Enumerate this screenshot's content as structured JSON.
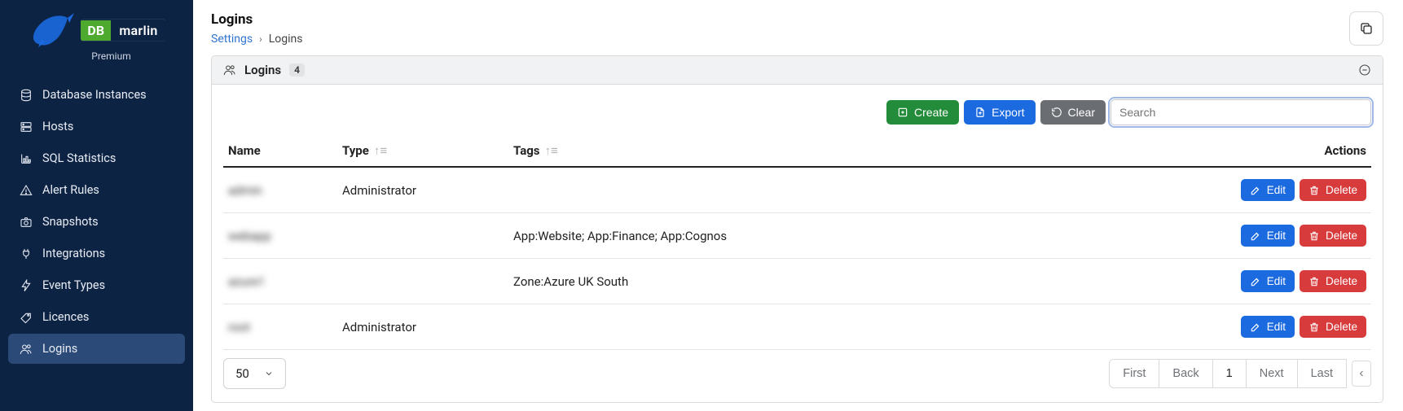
{
  "brand": {
    "db": "DB",
    "marlin": "marlin",
    "tier": "Premium"
  },
  "sidebar": {
    "items": [
      {
        "label": "Database Instances",
        "name": "nav-database-instances",
        "icon": "database-icon"
      },
      {
        "label": "Hosts",
        "name": "nav-hosts",
        "icon": "server-icon"
      },
      {
        "label": "SQL Statistics",
        "name": "nav-sql-statistics",
        "icon": "bar-chart-icon"
      },
      {
        "label": "Alert Rules",
        "name": "nav-alert-rules",
        "icon": "alert-icon"
      },
      {
        "label": "Snapshots",
        "name": "nav-snapshots",
        "icon": "camera-icon"
      },
      {
        "label": "Integrations",
        "name": "nav-integrations",
        "icon": "plug-icon"
      },
      {
        "label": "Event Types",
        "name": "nav-event-types",
        "icon": "lightning-icon"
      },
      {
        "label": "Licences",
        "name": "nav-licences",
        "icon": "tag-icon"
      },
      {
        "label": "Logins",
        "name": "nav-logins",
        "icon": "users-icon",
        "active": true
      }
    ]
  },
  "header": {
    "title": "Logins",
    "breadcrumb": {
      "parent": "Settings",
      "current": "Logins"
    }
  },
  "panel": {
    "title": "Logins",
    "count": "4"
  },
  "toolbar": {
    "create": "Create",
    "export": "Export",
    "clear": "Clear",
    "search_placeholder": "Search"
  },
  "table": {
    "columns": {
      "name": "Name",
      "type": "Type",
      "tags": "Tags",
      "actions": "Actions"
    },
    "actions": {
      "edit": "Edit",
      "delete": "Delete"
    },
    "rows": [
      {
        "name": "admin",
        "type": "Administrator",
        "tags": ""
      },
      {
        "name": "webapp",
        "type": "",
        "tags": "App:Website; App:Finance; App:Cognos"
      },
      {
        "name": "azure1",
        "type": "",
        "tags": "Zone:Azure UK South"
      },
      {
        "name": "root",
        "type": "Administrator",
        "tags": ""
      }
    ]
  },
  "pagination": {
    "page_size": "50",
    "first": "First",
    "back": "Back",
    "current": "1",
    "next": "Next",
    "last": "Last"
  },
  "colors": {
    "sidebar_bg": "#0d2344",
    "active_nav": "#2b4a78",
    "btn_green": "#228c3a",
    "btn_blue": "#1b6ae0",
    "btn_grey": "#6a6e73",
    "btn_red": "#d83b3b",
    "link": "#2f74d0"
  }
}
